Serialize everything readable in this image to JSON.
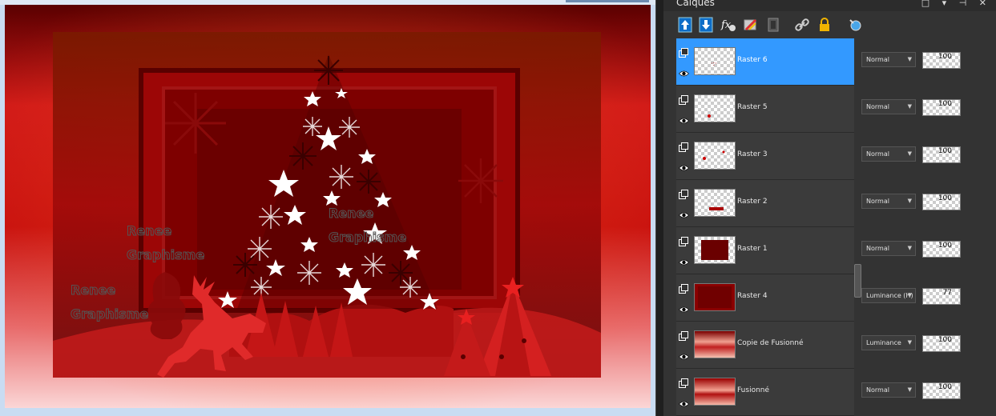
{
  "panel": {
    "title": "Calques",
    "window_icons": "□ ▾ ⊣ ✕"
  },
  "toolbar": {
    "icons": [
      "new-raster-layer-icon",
      "new-vector-layer-icon",
      "layer-style-icon",
      "adjustment-layer-icon",
      "mask-layer-icon",
      "link-layer-icon",
      "lock-layer-icon",
      "layer-visibility-toggle-icon"
    ]
  },
  "layers": [
    {
      "name": "Raster 6",
      "blend": "Normal",
      "opacity": "100",
      "selected": true
    },
    {
      "name": "Raster 5",
      "blend": "Normal",
      "opacity": "100",
      "selected": false
    },
    {
      "name": "Raster 3",
      "blend": "Normal",
      "opacity": "100",
      "selected": false
    },
    {
      "name": "Raster 2",
      "blend": "Normal",
      "opacity": "100",
      "selected": false
    },
    {
      "name": "Raster 1",
      "blend": "Normal",
      "opacity": "100",
      "selected": false
    },
    {
      "name": "Raster 4",
      "blend": "Luminance (H)",
      "opacity": "77",
      "selected": false
    },
    {
      "name": "Copie de Fusionné",
      "blend": "Luminance",
      "opacity": "100",
      "selected": false
    },
    {
      "name": "Fusionné",
      "blend": "Normal",
      "opacity": "100",
      "selected": false
    }
  ],
  "watermark": {
    "line1": "Renee",
    "line2": "Graphisme"
  },
  "colors": {
    "selection": "#3399ff",
    "panel_bg": "#333333",
    "art_red": "#c0101a",
    "art_dark": "#6b0000"
  }
}
